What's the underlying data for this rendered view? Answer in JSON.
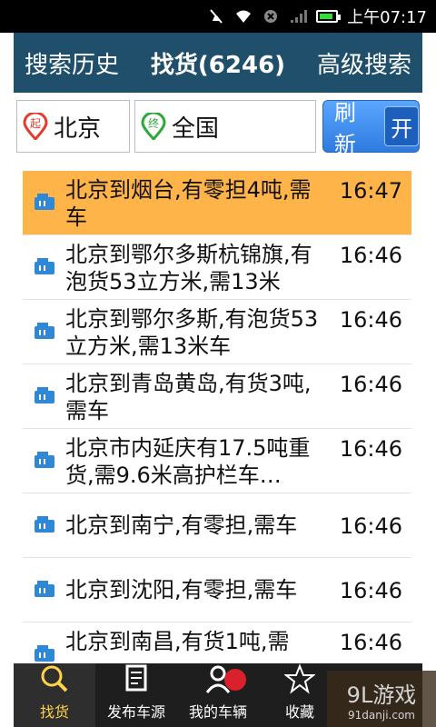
{
  "status_bar": {
    "time": "上午07:17"
  },
  "header": {
    "tabs": [
      {
        "label": "搜索历史"
      },
      {
        "label": "找货(6246)"
      },
      {
        "label": "高级搜索"
      }
    ]
  },
  "search": {
    "from_badge": "起",
    "from_city": "北京",
    "to_badge": "终",
    "to_city": "全国",
    "refresh_label": "刷新",
    "toggle_label": "开"
  },
  "list": [
    {
      "text": "北京到烟台,有零担4吨,需车",
      "time": "16:47",
      "highlight": true
    },
    {
      "text": "北京到鄂尔多斯杭锦旗,有泡货53立方米,需13米",
      "time": "16:46"
    },
    {
      "text": "北京到鄂尔多斯,有泡货53立方米,需13米车",
      "time": "16:46"
    },
    {
      "text": "北京到青岛黄岛,有货3吨,需车",
      "time": "16:46"
    },
    {
      "text": "北京市内延庆有17.5吨重货,需9.6米高护栏车…",
      "time": "16:46"
    },
    {
      "text": "北京到南宁,有零担,需车",
      "time": "16:46"
    },
    {
      "text": "北京到沈阳,有零担,需车",
      "time": "16:46"
    },
    {
      "text": "北京到南昌,有货1吨,需",
      "time": "16:46"
    }
  ],
  "bottom_nav": [
    {
      "label": "找货",
      "icon": "search-icon"
    },
    {
      "label": "发布车源",
      "icon": "document-icon"
    },
    {
      "label": "我的车辆",
      "icon": "user-icon"
    },
    {
      "label": "收藏",
      "icon": "star-icon"
    }
  ],
  "watermark": {
    "main": "9L游戏",
    "sub": "91danji.com"
  }
}
